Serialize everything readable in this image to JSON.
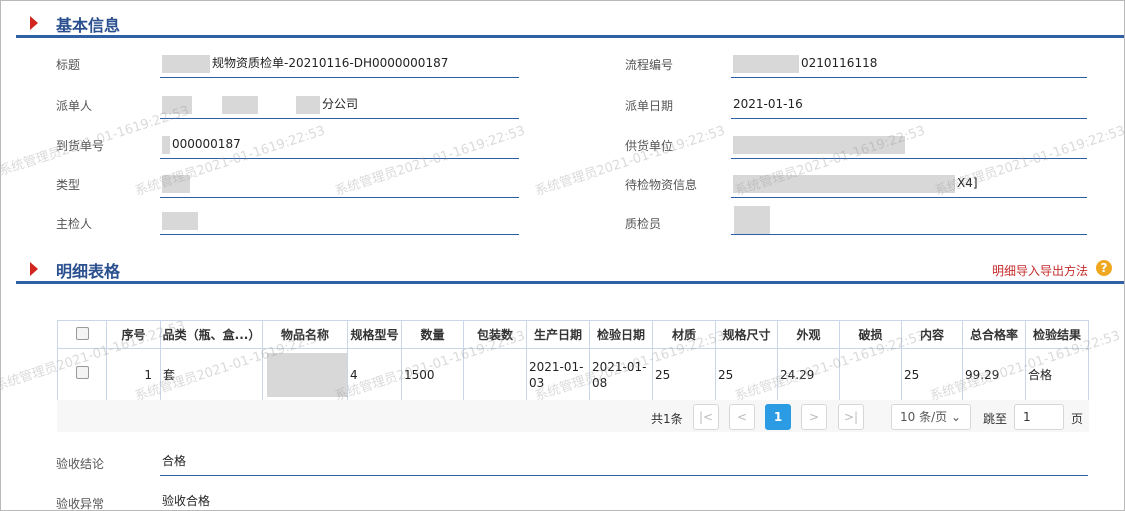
{
  "basic_section": {
    "title": "基本信息"
  },
  "fields": {
    "title_label": "标题",
    "title_value": "规物资质检单-20210116-DH0000000187",
    "flow_label": "流程编号",
    "flow_value": "0210116118",
    "dispatcher_label": "派单人",
    "dispatcher_value": "分公司",
    "date_label": "派单日期",
    "date_value": "2021-01-16",
    "arrival_label": "到货单号",
    "arrival_value": "000000187",
    "supplier_label": "供货单位",
    "supplier_value": "",
    "type_label": "类型",
    "type_value": "",
    "pending_label": "待检物资信息",
    "pending_value": "X4]",
    "inspector_label": "主检人",
    "inspector_value": "",
    "qc_label": "质检员",
    "qc_value": ""
  },
  "detail_section": {
    "title": "明细表格",
    "help_link": "明细导入导出方法",
    "help_icon": "?"
  },
  "table": {
    "headers": [
      "序号",
      "品类（瓶、盒...）",
      "物品名称",
      "规格型号",
      "数量",
      "包装数",
      "生产日期",
      "检验日期",
      "材质",
      "规格尺寸",
      "外观",
      "破损",
      "内容",
      "总合格率",
      "检验结果"
    ],
    "rows": [
      [
        "1",
        "套",
        "",
        "4",
        "1500",
        "",
        "2021-01-03",
        "2021-01-08",
        "25",
        "25",
        "24.29",
        "",
        "25",
        "99.29",
        "合格"
      ]
    ]
  },
  "pager": {
    "total": "共1条",
    "first": "|<",
    "prev": "<",
    "current": "1",
    "next": ">",
    "last": ">|",
    "page_size": "10 条/页",
    "jump_label": "跳至",
    "jump_value": "1",
    "page_unit": "页"
  },
  "conclusion": {
    "result_label": "验收结论",
    "result_value": "合格",
    "abnormal_label": "验收异常",
    "abnormal_value": "验收合格"
  },
  "watermark": "系统管理员2021-01-1619:22:53"
}
